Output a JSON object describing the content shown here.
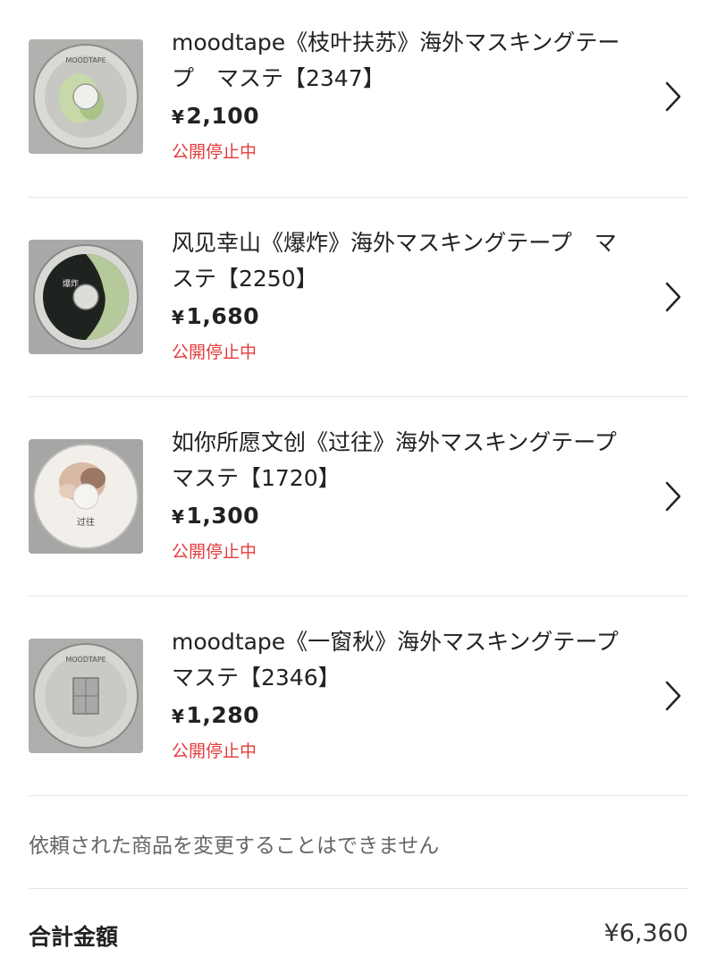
{
  "items": [
    {
      "title": "moodtape《枝叶扶苏》海外マスキングテープ　マステ【2347】",
      "yen": "¥",
      "price": "2,100",
      "status": "公開停止中"
    },
    {
      "title": "风见幸山《爆炸》海外マスキングテープ　マステ【2250】",
      "yen": "¥",
      "price": "1,680",
      "status": "公開停止中"
    },
    {
      "title": "如你所愿文创《过往》海外マスキングテープ　マステ【1720】",
      "yen": "¥",
      "price": "1,300",
      "status": "公開停止中"
    },
    {
      "title": "moodtape《一窗秋》海外マスキングテープ　マステ【2346】",
      "yen": "¥",
      "price": "1,280",
      "status": "公開停止中"
    }
  ],
  "thumb_labels": {
    "item1": "MOODTAPE",
    "item2": "爆炸",
    "item3": "过往",
    "item4": "MOODTAPE"
  },
  "note": "依頼された商品を変更することはできません",
  "total": {
    "label": "合計金額",
    "amount": "¥6,360"
  },
  "colors": {
    "status": "#e33b3b",
    "divider": "#e6e6e6",
    "chevron": "#222222"
  },
  "icons": [
    "chevron-right-icon"
  ]
}
